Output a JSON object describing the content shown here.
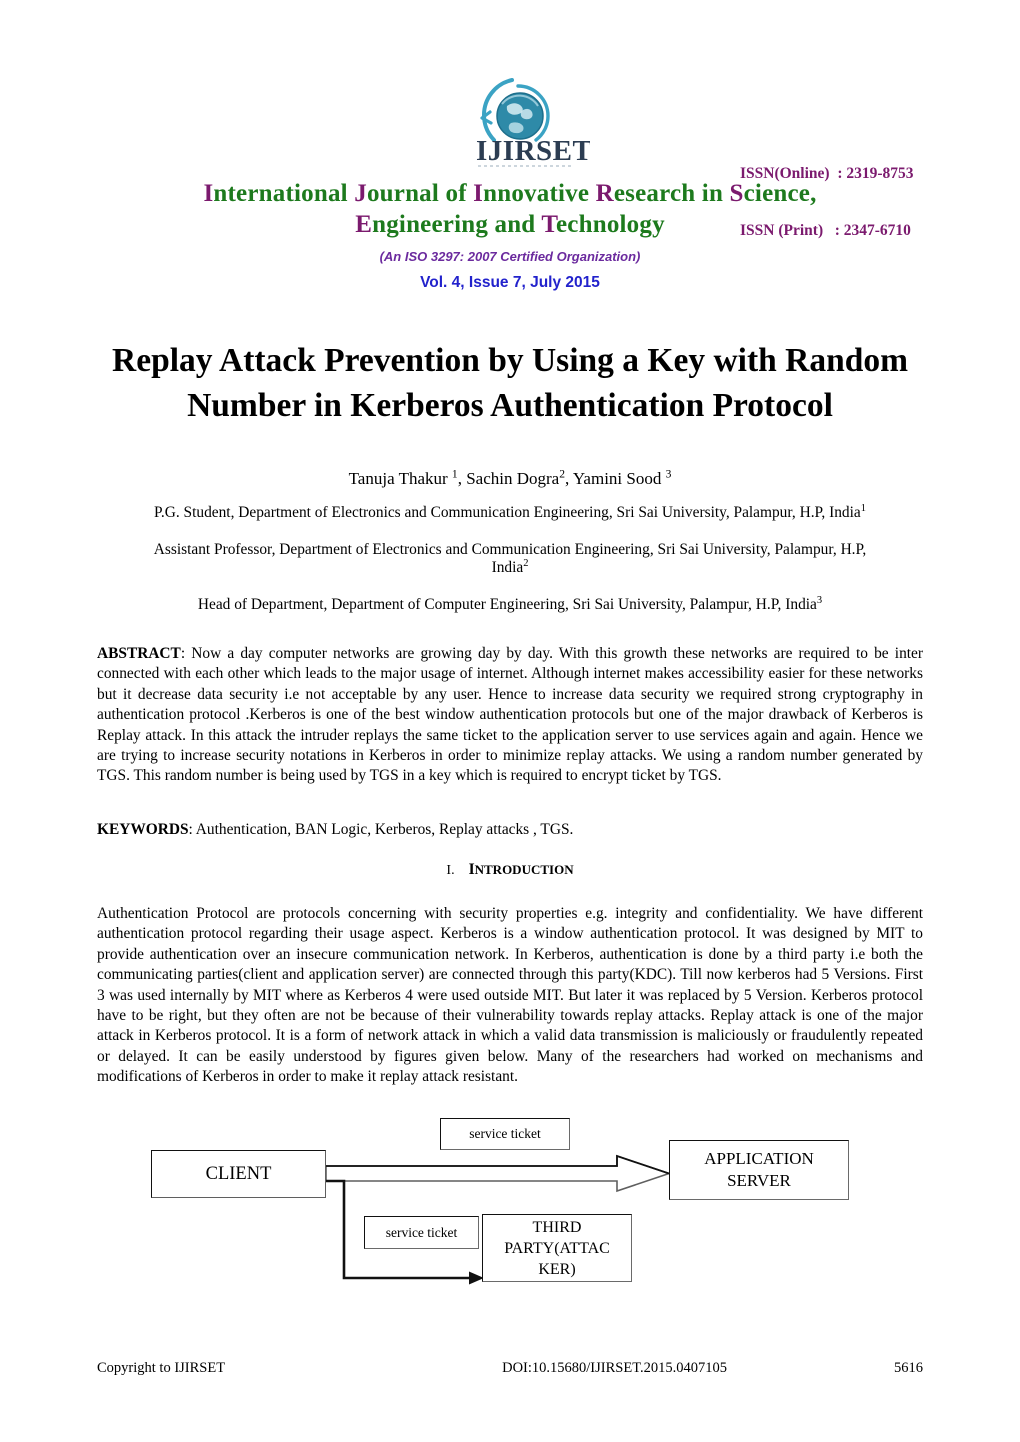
{
  "masthead": {
    "logo_text": "IJIRSET",
    "issn_online": "ISSN(Online)  : 2319-8753",
    "issn_print": "ISSN (Print)   : 2347-6710",
    "journal_name_line1": "International Journal of Innovative Research in Science,",
    "journal_name_line2": "Engineering and Technology",
    "iso_line": "(An ISO 3297: 2007 Certified Organization)",
    "volume_line": "Vol. 4, Issue 7, July 2015",
    "colors": {
      "capital": "#7b1a6e",
      "lowercase": "#1d7a1d",
      "issn": "#7b1a6e",
      "iso": "#6b2a9e",
      "volume": "#2222cc",
      "logo": "#2a8fa8"
    }
  },
  "paper": {
    "title": "Replay Attack Prevention by Using a Key with Random Number in Kerberos Authentication Protocol",
    "authors_plain": "Tanuja Thakur 1, Sachin Dogra2, Yamini Sood 3",
    "affiliations": [
      "P.G. Student, Department of Electronics and Communication Engineering, Sri Sai University, Palampur, H.P, India1",
      "Assistant Professor, Department of Electronics and Communication Engineering, Sri Sai University, Palampur, H.P, India2",
      "Head of Department, Department of Computer Engineering, Sri Sai University, Palampur, H.P, India3"
    ],
    "abstract_label": "ABSTRACT",
    "abstract_text": ": Now a day computer networks are growing day by day. With this growth these networks are required to be inter connected with each other which leads to the major usage of internet. Although internet makes accessibility easier  for these networks but it decrease data security i.e not acceptable by any user. Hence to increase data security we required strong cryptography in authentication protocol .Kerberos is one of the best window authentication protocols but one of the major drawback of Kerberos is Replay attack. In this attack the intruder replays the same ticket to the application server to use services again and again. Hence we are trying to increase security notations in Kerberos in order to minimize replay attacks. We using  a random number generated by TGS. This random number is being used by TGS in a key  which is required to encrypt ticket by TGS.",
    "keywords_label": "KEYWORDS",
    "keywords_text": ": Authentication, BAN Logic, Kerberos, Replay attacks , TGS.",
    "section_number": "I.",
    "section_title": "INTRODUCTION",
    "intro_text": "Authentication Protocol are  protocols concerning with security properties e.g. integrity and confidentiality. We have different authentication protocol regarding their usage aspect. Kerberos is a window authentication protocol. It was designed by MIT to provide authentication over an insecure communication  network. In Kerberos, authentication is done by a third party i.e both the communicating parties(client and application server) are connected through this party(KDC). Till now kerberos had 5 Versions. First 3 was used internally by MIT  where as Kerberos 4 were used outside MIT. But later it was replaced by 5 Version. Kerberos protocol have to be right, but they often are not be because of their  vulnerability towards replay attacks. Replay attack is one of the major attack in Kerberos protocol. It is a form of network attack in which a valid data transmission is maliciously or fraudulently   repeated or delayed. It can be easily understood by figures given below. Many of the researchers had worked on  mechanisms and modifications of Kerberos in order to make it replay attack resistant."
  },
  "figure": {
    "client_label": "CLIENT",
    "app_server_label": "APPLICATION SERVER",
    "app_server_line1": "APPLICATION",
    "app_server_line2": "SERVER",
    "ticket_top_label": "service ticket",
    "ticket_bottom_label": "service ticket",
    "third_party_line1": "THIRD",
    "third_party_line2": "PARTY(ATTAC",
    "third_party_line3": "KER)"
  },
  "footer": {
    "copyright": "Copyright to IJIRSET",
    "doi": "DOI:10.15680/IJIRSET.2015.0407105",
    "page_number": "5616"
  }
}
